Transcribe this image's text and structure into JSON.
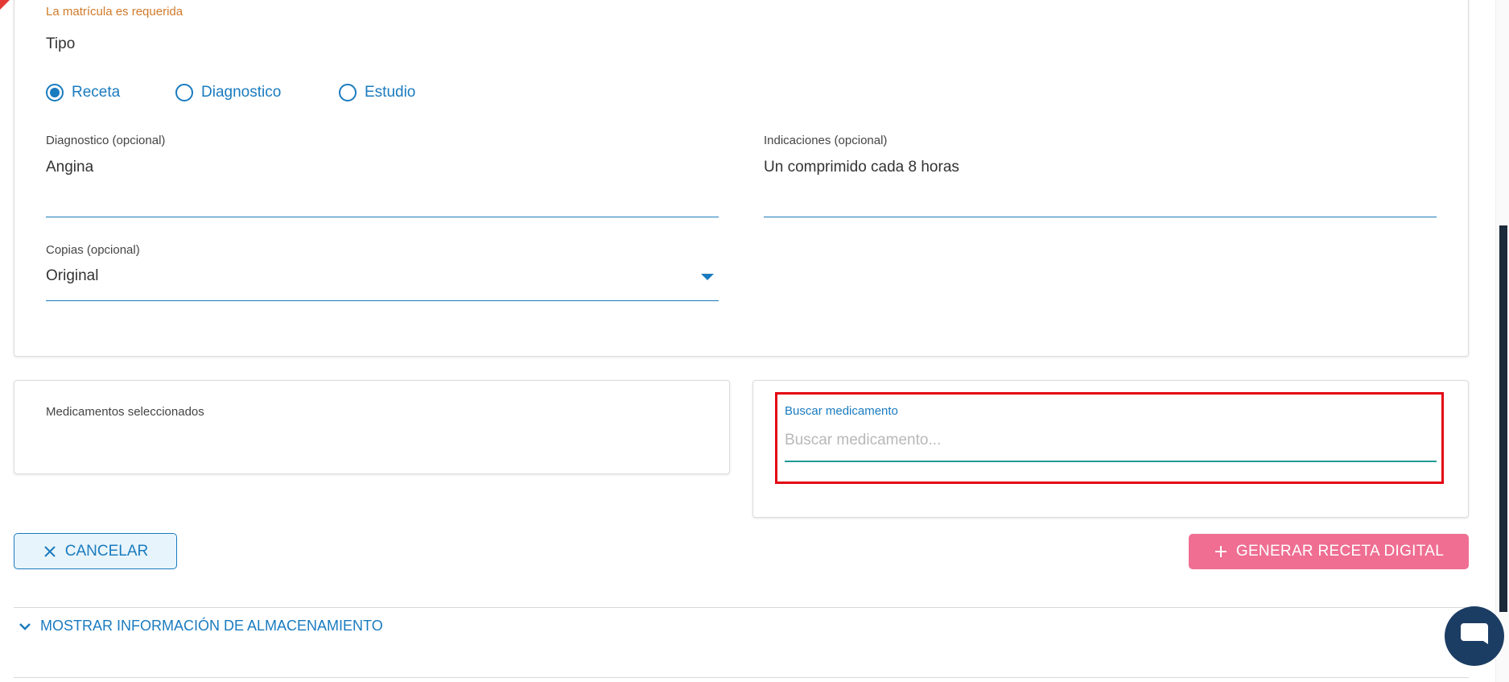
{
  "form": {
    "error_matricula": "La matrícula es requerida",
    "tipo_label": "Tipo",
    "tipo_options": [
      {
        "label": "Receta",
        "checked": true
      },
      {
        "label": "Diagnostico",
        "checked": false
      },
      {
        "label": "Estudio",
        "checked": false
      }
    ],
    "diagnostico": {
      "label": "Diagnostico (opcional)",
      "value": "Angina"
    },
    "indicaciones": {
      "label": "Indicaciones (opcional)",
      "value": "Un comprimido cada 8 horas"
    },
    "copias": {
      "label": "Copias (opcional)",
      "value": "Original"
    }
  },
  "medicamentos": {
    "selected_title": "Medicamentos seleccionados",
    "search_label": "Buscar medicamento",
    "search_placeholder": "Buscar medicamento...",
    "search_value": ""
  },
  "actions": {
    "cancel_label": "CANCELAR",
    "generate_label": "GENERAR RECETA DIGITAL"
  },
  "storage": {
    "toggle_label": "MOSTRAR INFORMACIÓN DE ALMACENAMIENTO"
  },
  "colors": {
    "primary": "#1a7bbf",
    "generate_button": "#ef6e92",
    "error_text": "#d07a2a",
    "highlight_border": "#e30613",
    "chat_button": "#1c3d63"
  }
}
